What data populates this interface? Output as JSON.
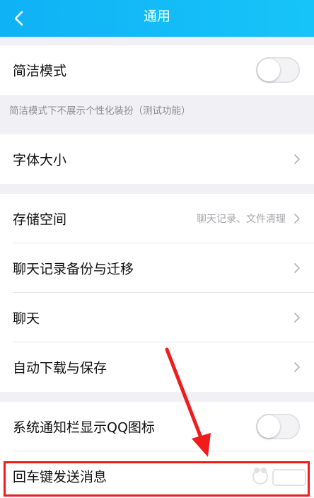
{
  "header": {
    "title": "通用",
    "back_icon": "chevron-left-icon"
  },
  "rows": {
    "simple_mode": {
      "label": "简洁模式",
      "toggle_on": false
    },
    "simple_mode_hint": "简洁模式下不展示个性化装扮（测试功能）",
    "font_size": {
      "label": "字体大小"
    },
    "storage": {
      "label": "存储空间",
      "value": "聊天记录、文件清理"
    },
    "backup": {
      "label": "聊天记录备份与迁移"
    },
    "chat": {
      "label": "聊天"
    },
    "auto_download": {
      "label": "自动下载与保存"
    },
    "notification_icon": {
      "label": "系统通知栏显示QQ图标",
      "toggle_on": false
    },
    "enter_send": {
      "label": "回车键发送消息"
    }
  },
  "annotations": {
    "highlight_color": "#f01c1c"
  },
  "colors": {
    "header_start": "#0fb2f5",
    "header_end": "#17c4f9",
    "page_bg": "#f0f0f5"
  }
}
